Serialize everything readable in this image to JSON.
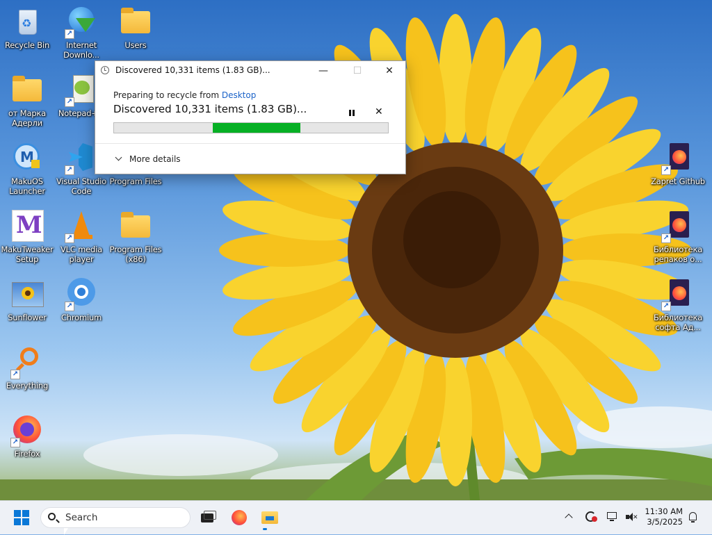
{
  "desktop": {
    "icons": [
      {
        "label": "Recycle Bin"
      },
      {
        "label": "Internet Downlo..."
      },
      {
        "label": "Users"
      },
      {
        "label": "от Марка Адерли"
      },
      {
        "label": "Notepad++"
      },
      {
        "label": "MakuOS Launcher"
      },
      {
        "label": "Visual Studio Code"
      },
      {
        "label": "Program Files"
      },
      {
        "label": "MakuTweaker Setup"
      },
      {
        "label": "VLC media player"
      },
      {
        "label": "Program Files (x86)"
      },
      {
        "label": "Sunflower"
      },
      {
        "label": "Chromium"
      },
      {
        "label": "Everything"
      },
      {
        "label": "Firefox"
      },
      {
        "label": "Zapret Github"
      },
      {
        "label": "Библиотека репаков о..."
      },
      {
        "label": "Библиотека софта Ад..."
      }
    ]
  },
  "dialog": {
    "title": "Discovered 10,331 items (1.83 GB)...",
    "preparing_prefix": "Preparing to recycle from ",
    "source_link": "Desktop",
    "status": "Discovered 10,331 items (1.83 GB)...",
    "progress": {
      "start_fraction": 0.36,
      "end_fraction": 0.68,
      "color": "#06b025"
    },
    "more_details": "More details",
    "close_glyph": "✕",
    "minimize_glyph": "—",
    "maximize_glyph": "☐",
    "cancel_glyph": "✕"
  },
  "taskbar": {
    "search_placeholder": "Search",
    "time": "11:30 AM",
    "date": "3/5/2025",
    "accent": "#0a78d7"
  }
}
